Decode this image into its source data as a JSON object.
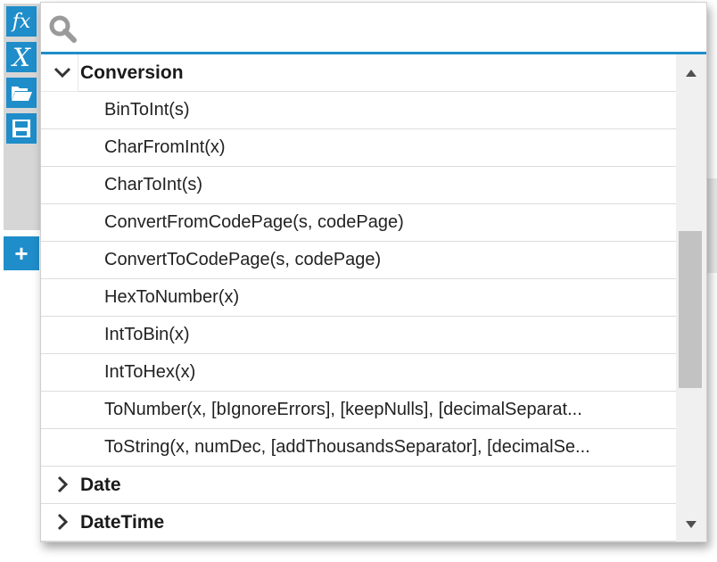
{
  "toolbar": {
    "fx_label": "fx",
    "x_label": "X",
    "open_icon": "folder-open-icon",
    "save_icon": "save-icon",
    "add_label": "+"
  },
  "search": {
    "value": "",
    "placeholder": ""
  },
  "categories": [
    {
      "label": "Conversion",
      "expanded": true,
      "items": [
        "BinToInt(s)",
        "CharFromInt(x)",
        "CharToInt(s)",
        "ConvertFromCodePage(s, codePage)",
        "ConvertToCodePage(s, codePage)",
        "HexToNumber(x)",
        "IntToBin(x)",
        "IntToHex(x)",
        "ToNumber(x, [bIgnoreErrors], [keepNulls], [decimalSeparat...",
        "ToString(x, numDec, [addThousandsSeparator], [decimalSe..."
      ]
    },
    {
      "label": "Date",
      "expanded": false
    },
    {
      "label": "DateTime",
      "expanded": false
    }
  ],
  "colors": {
    "accent": "#1f8dc9",
    "toolbar_bg": "#d6d6d6",
    "scroll_thumb": "#c2c2c2"
  }
}
